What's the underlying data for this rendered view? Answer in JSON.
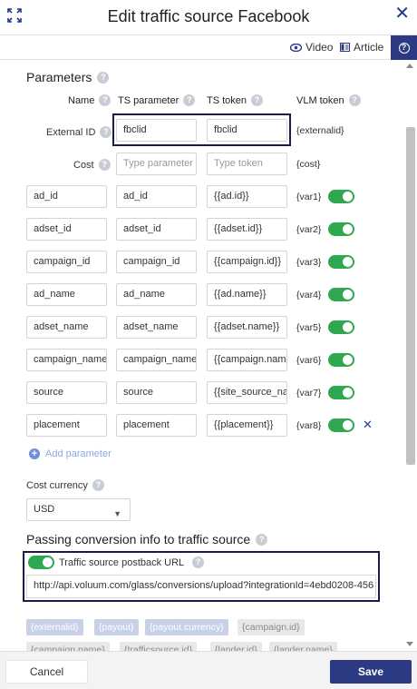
{
  "header": {
    "title": "Edit traffic source Facebook"
  },
  "subbar": {
    "video_label": "Video",
    "article_label": "Article"
  },
  "parameters": {
    "section_title": "Parameters",
    "col_name": "Name",
    "col_ts_param": "TS parameter",
    "col_ts_token": "TS token",
    "col_vlm_token": "VLM token",
    "external_id": {
      "label": "External ID",
      "ts_param": "fbclid",
      "ts_token": "fbclid",
      "vlm": "{externalid}"
    },
    "cost": {
      "label": "Cost",
      "ts_param_placeholder": "Type parameter",
      "ts_token_placeholder": "Type token",
      "vlm": "{cost}"
    },
    "rows": [
      {
        "name": "ad_id",
        "param": "ad_id",
        "token": "{{ad.id}}",
        "vlm": "{var1}",
        "enabled": true
      },
      {
        "name": "adset_id",
        "param": "adset_id",
        "token": "{{adset.id}}",
        "vlm": "{var2}",
        "enabled": true
      },
      {
        "name": "campaign_id",
        "param": "campaign_id",
        "token": "{{campaign.id}}",
        "vlm": "{var3}",
        "enabled": true
      },
      {
        "name": "ad_name",
        "param": "ad_name",
        "token": "{{ad.name}}",
        "vlm": "{var4}",
        "enabled": true
      },
      {
        "name": "adset_name",
        "param": "adset_name",
        "token": "{{adset.name}}",
        "vlm": "{var5}",
        "enabled": true
      },
      {
        "name": "campaign_name",
        "param": "campaign_name",
        "token": "{{campaign.name}}",
        "vlm": "{var6}",
        "enabled": true
      },
      {
        "name": "source",
        "param": "source",
        "token": "{{site_source_name}}",
        "vlm": "{var7}",
        "enabled": true
      },
      {
        "name": "placement",
        "param": "placement",
        "token": "{{placement}}",
        "vlm": "{var8}",
        "enabled": true
      }
    ],
    "add_label": "Add parameter"
  },
  "cost_currency": {
    "label": "Cost currency",
    "value": "USD"
  },
  "postback": {
    "section_title": "Passing conversion info to traffic source",
    "toggle_label": "Traffic source postback URL",
    "enabled": true,
    "url": "http://api.voluum.com/glass/conversions/upload?integrationId=4ebd0208-456"
  },
  "tokens": [
    "{externalid}",
    "{payout}",
    "{payout.currency}",
    "{campaign.id}",
    "{campaign.name}",
    "{trafficsource.id}",
    "{lander.id}",
    "{lander.name}"
  ],
  "footer": {
    "cancel_label": "Cancel",
    "save_label": "Save"
  },
  "colors": {
    "accent": "#2b3a82",
    "toggle_on": "#2fa84f",
    "highlight": "#1c1a4a"
  }
}
